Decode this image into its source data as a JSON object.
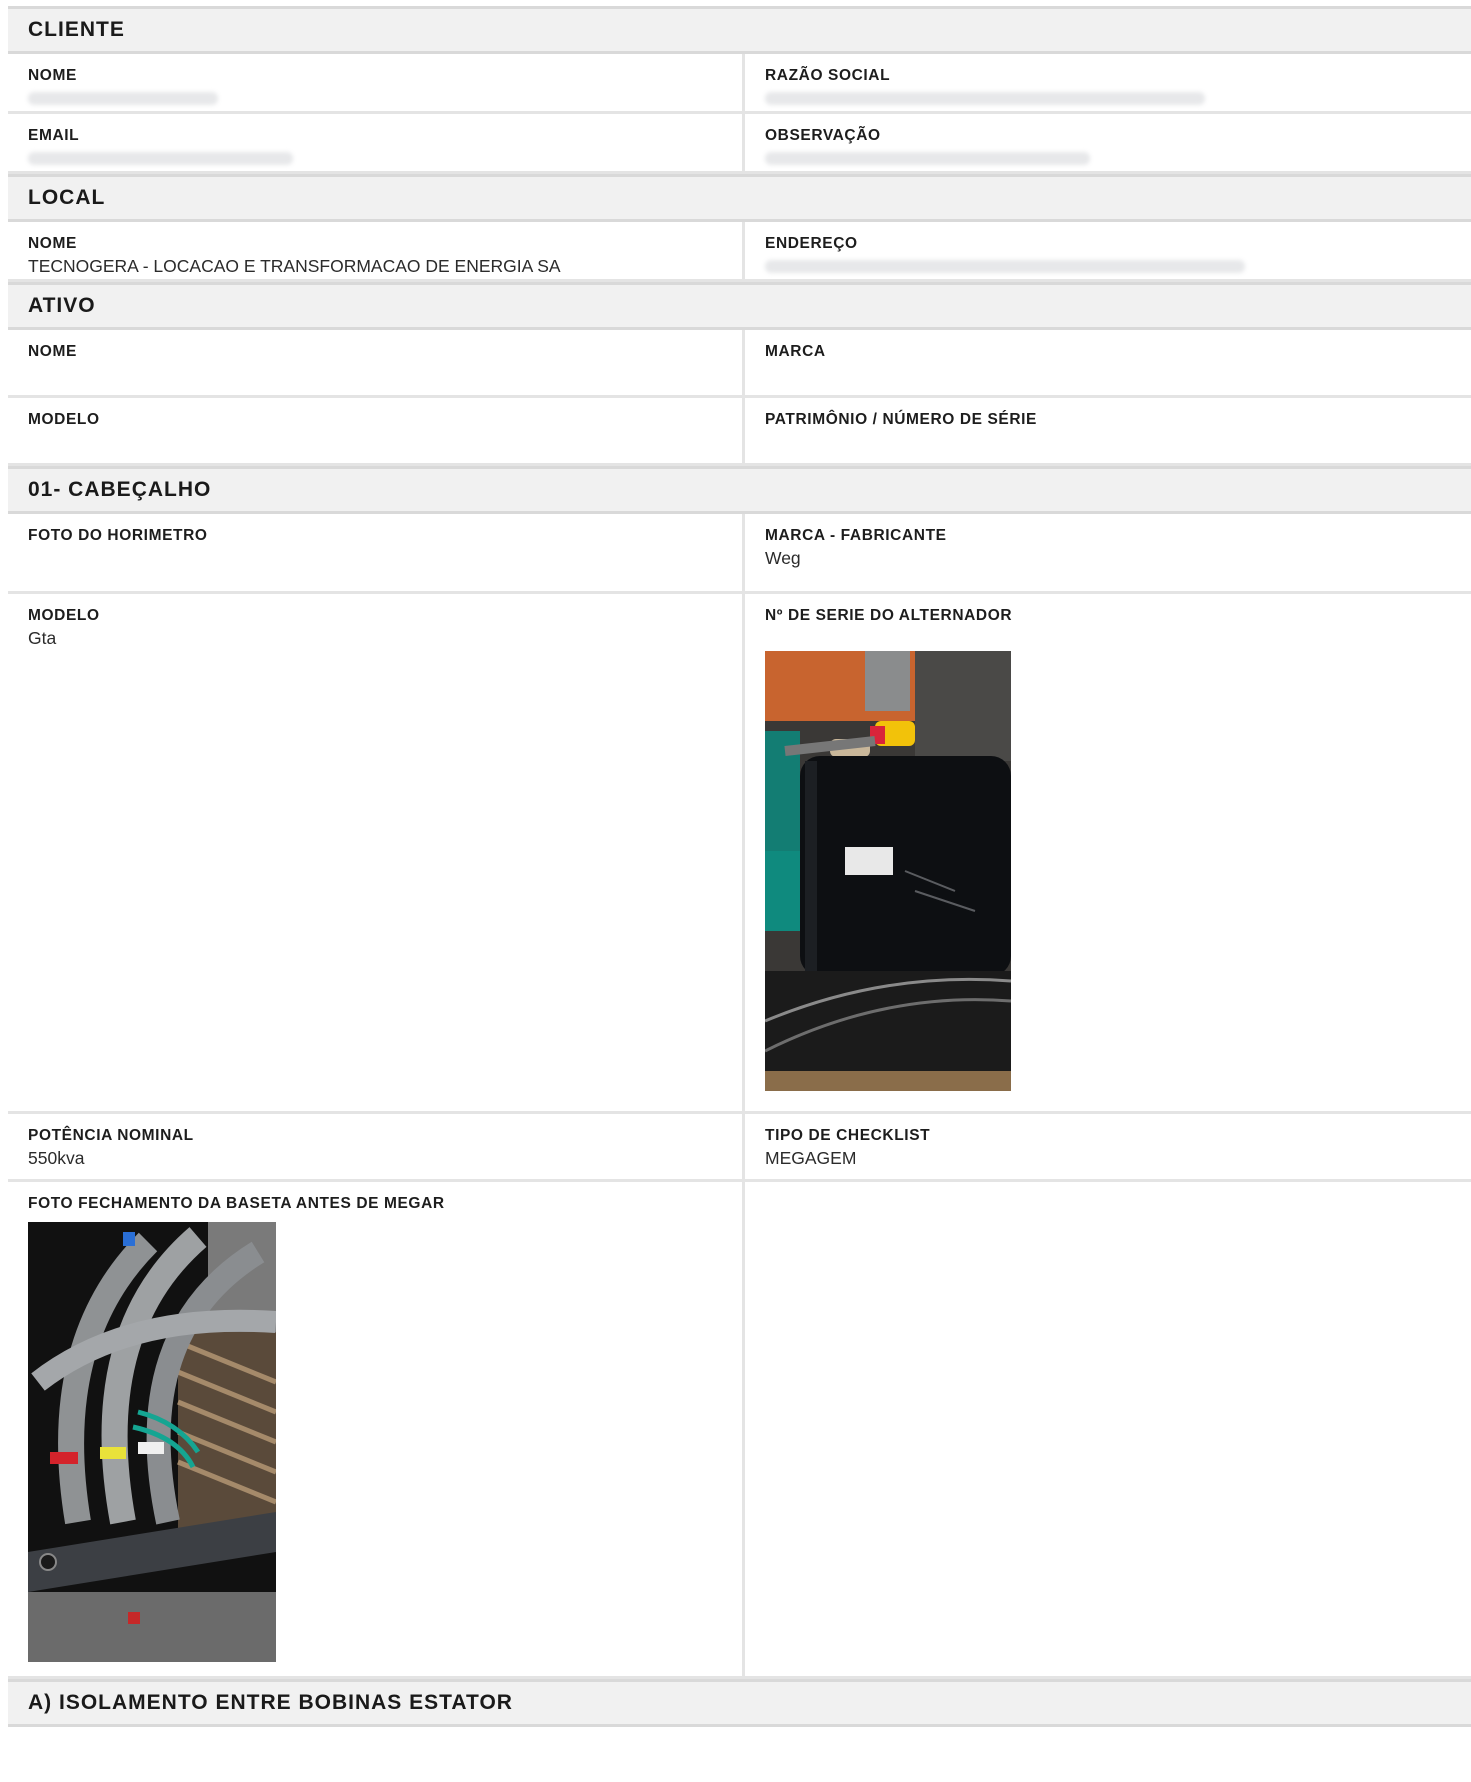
{
  "cliente": {
    "title": "CLIENTE",
    "nome_label": "NOME",
    "razao_label": "RAZÃO SOCIAL",
    "email_label": "EMAIL",
    "observacao_label": "OBSERVAÇÃO"
  },
  "local": {
    "title": "LOCAL",
    "nome_label": "NOME",
    "nome_value": "TECNOGERA - LOCACAO E TRANSFORMACAO DE ENERGIA SA",
    "endereco_label": "ENDEREÇO"
  },
  "ativo": {
    "title": "ATIVO",
    "nome_label": "NOME",
    "marca_label": "MARCA",
    "modelo_label": "MODELO",
    "patrimonio_label": "PATRIMÔNIO / NÚMERO DE SÉRIE"
  },
  "cabecalho": {
    "title": "01- CABEÇALHO",
    "foto_horimetro_label": "FOTO DO HORIMETRO",
    "marca_fabricante_label": "MARCA - FABRICANTE",
    "marca_fabricante_value": "Weg",
    "modelo_label": "MODELO",
    "modelo_value": "Gta",
    "serie_alternador_label": "Nº DE SERIE DO ALTERNADOR",
    "potencia_label": "POTÊNCIA NOMINAL",
    "potencia_value": "550kva",
    "tipo_checklist_label": "TIPO DE CHECKLIST",
    "tipo_checklist_value": "MEGAGEM",
    "foto_baseta_label": "FOTO FECHAMENTO DA BASETA ANTES DE MEGAR"
  },
  "isolamento": {
    "title": "A) ISOLAMENTO ENTRE BOBINAS ESTATOR"
  }
}
